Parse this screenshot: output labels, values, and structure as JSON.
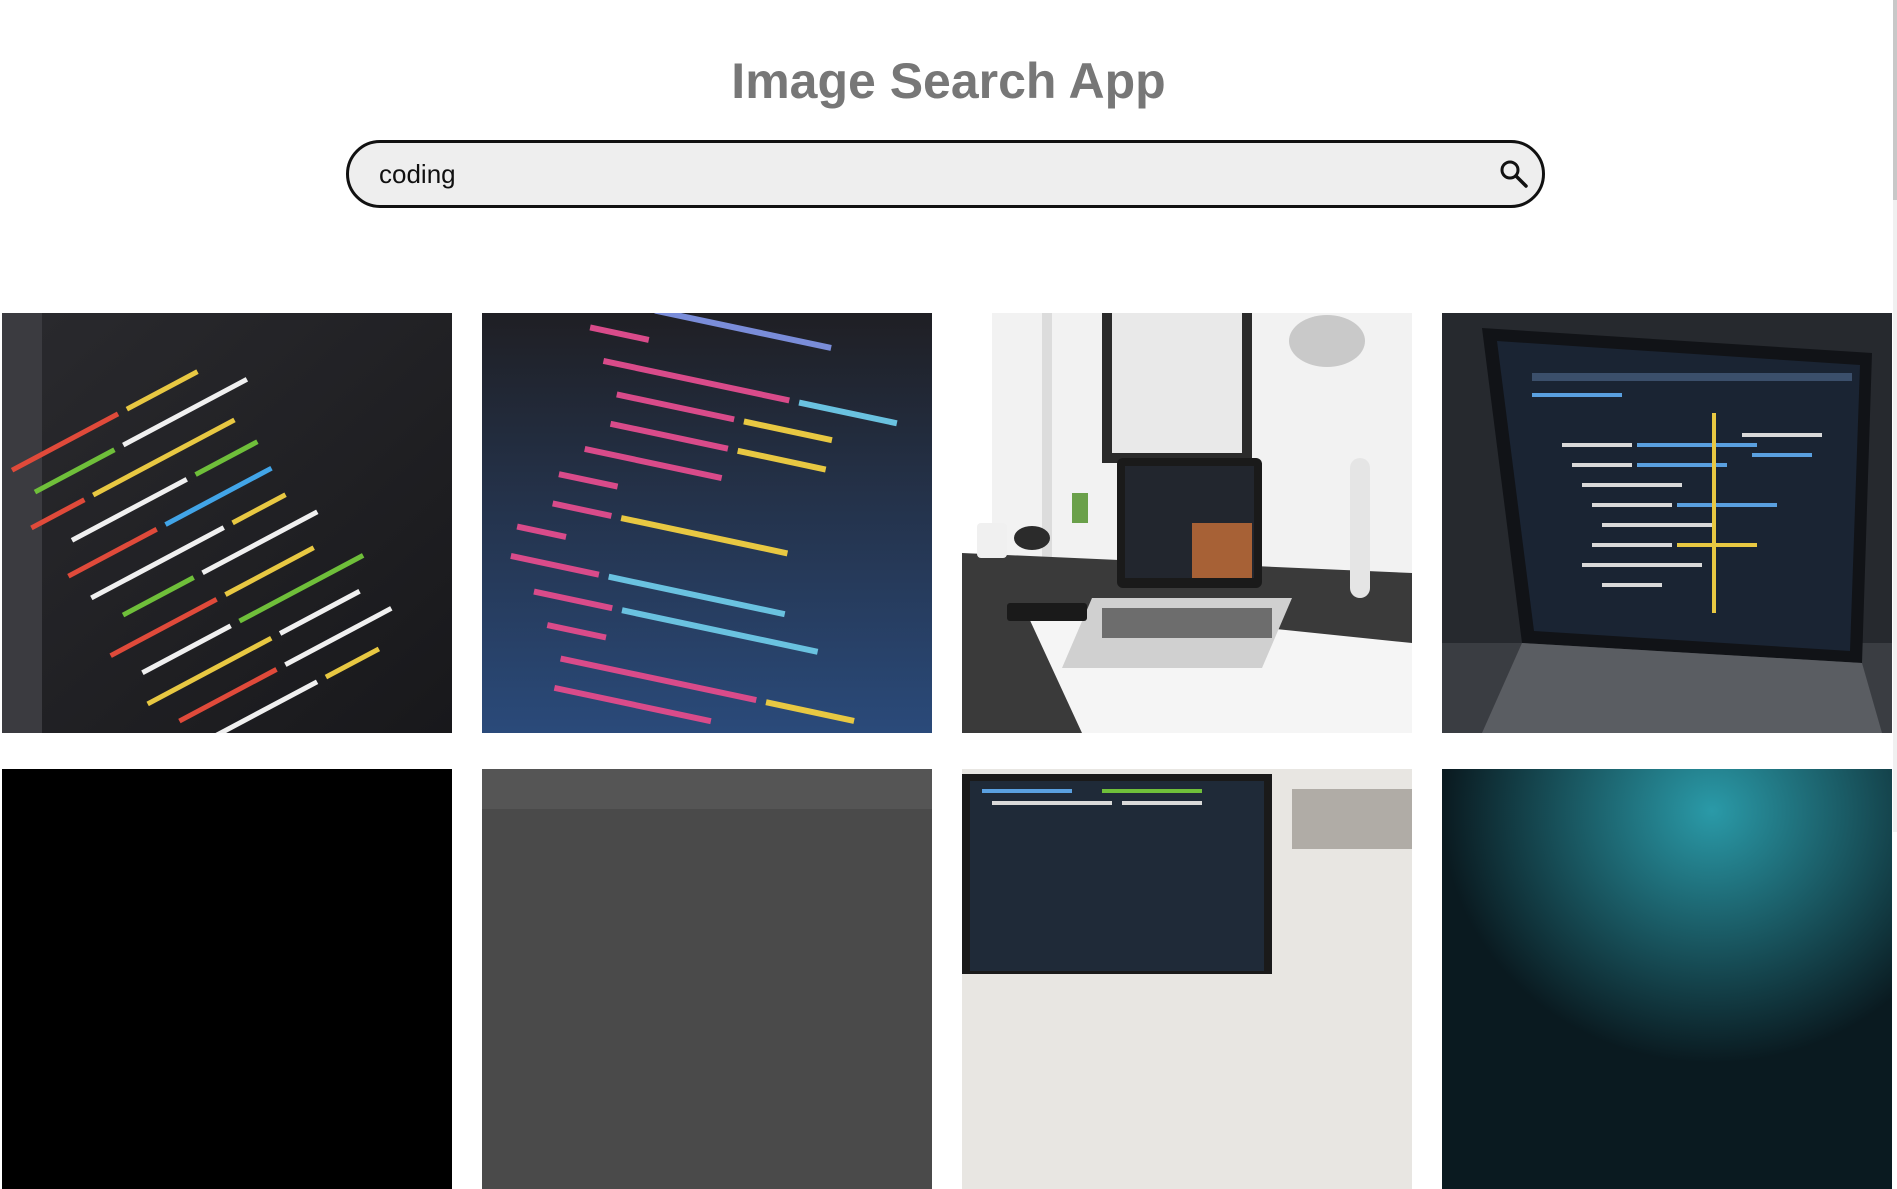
{
  "header": {
    "title": "Image Search App"
  },
  "search": {
    "value": "coding",
    "icon": "search-icon"
  },
  "results": [
    {
      "name": "result-image-1",
      "subject": "code-screen-closeup"
    },
    {
      "name": "result-image-2",
      "subject": "svg-code-editor"
    },
    {
      "name": "result-image-3",
      "subject": "laptop-on-white-desk"
    },
    {
      "name": "result-image-4",
      "subject": "dark-laptop-code"
    },
    {
      "name": "result-image-5",
      "subject": "black-image"
    },
    {
      "name": "result-image-6",
      "subject": "gray-image"
    },
    {
      "name": "result-image-7",
      "subject": "monitor-code"
    },
    {
      "name": "result-image-8",
      "subject": "teal-glow"
    }
  ],
  "colors": {
    "title": "#777777",
    "search_background": "#eeeeee",
    "search_border": "#111111"
  }
}
